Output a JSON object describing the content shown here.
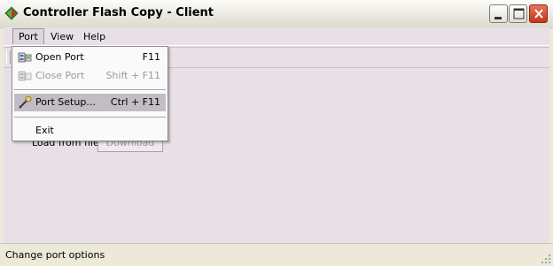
{
  "window": {
    "title": "Controller Flash Copy - Client"
  },
  "menubar": {
    "port": "Port",
    "view": "View",
    "help": "Help"
  },
  "port_menu": {
    "items": [
      {
        "label": "Open Port",
        "shortcut": "F11",
        "enabled": true,
        "icon": "open-port-icon"
      },
      {
        "label": "Close Port",
        "shortcut": "Shift + F11",
        "enabled": false,
        "icon": "close-port-icon"
      },
      {
        "label": "Port Setup...",
        "shortcut": "Ctrl + F11",
        "enabled": true,
        "highlighted": true,
        "icon": "port-setup-icon"
      },
      {
        "label": "Exit",
        "shortcut": "",
        "enabled": true
      }
    ]
  },
  "main": {
    "load_label": "Load from file",
    "download_button": "Download"
  },
  "statusbar": {
    "text": "Change port options"
  }
}
